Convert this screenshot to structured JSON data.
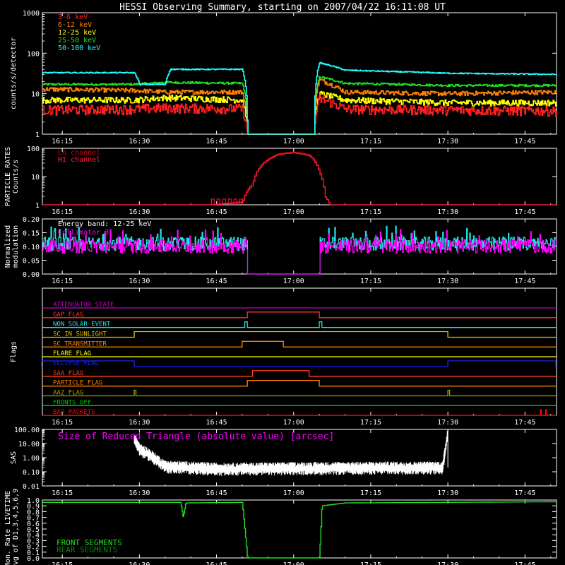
{
  "chart_data": {
    "type": "line",
    "title": "HESSI Observing Summary, starting on 2007/04/22 16:11:08 UT",
    "x_axis": {
      "units": "UT time",
      "range": [
        "16:11:08",
        "17:51:08"
      ],
      "tick_labels": [
        "16:15",
        "16:30",
        "16:45",
        "17:00",
        "17:15",
        "17:30",
        "17:45"
      ]
    },
    "panels": [
      {
        "id": "count-rates",
        "ylabel": "counts/s/detector",
        "yscale": "log",
        "ylim": [
          1,
          1000
        ],
        "tick_labels": [
          "1",
          "10",
          "100",
          "1000"
        ],
        "legend_position": "top-left",
        "series": [
          {
            "name": "3-6 keV",
            "color": "#ff2020",
            "points": [
              [
                "16:11",
                4.0
              ],
              [
                "16:29",
                4.2
              ],
              [
                "16:35",
                4.5
              ],
              [
                "16:50",
                4.3
              ],
              [
                "16:51",
                1.0
              ],
              [
                "17:04",
                1.0
              ],
              [
                "17:05",
                7.5
              ],
              [
                "17:10",
                4.2
              ],
              [
                "17:30",
                4.0
              ],
              [
                "17:51",
                3.8
              ]
            ]
          },
          {
            "name": "6-12 keV",
            "color": "#ff8000",
            "points": [
              [
                "16:11",
                13
              ],
              [
                "16:29",
                12
              ],
              [
                "16:35",
                11
              ],
              [
                "16:50",
                11
              ],
              [
                "16:51",
                1.0
              ],
              [
                "17:04",
                1.0
              ],
              [
                "17:05",
                22
              ],
              [
                "17:10",
                11
              ],
              [
                "17:30",
                10
              ],
              [
                "17:51",
                11
              ]
            ]
          },
          {
            "name": "12-25 keV",
            "color": "#ffff00",
            "points": [
              [
                "16:11",
                7
              ],
              [
                "16:29",
                7
              ],
              [
                "16:35",
                8
              ],
              [
                "16:50",
                7
              ],
              [
                "16:51",
                1.0
              ],
              [
                "17:04",
                1.0
              ],
              [
                "17:05",
                10
              ],
              [
                "17:10",
                7
              ],
              [
                "17:30",
                6
              ],
              [
                "17:51",
                6
              ]
            ]
          },
          {
            "name": "25-50 keV",
            "color": "#20e020",
            "points": [
              [
                "16:11",
                17
              ],
              [
                "16:29",
                17
              ],
              [
                "16:35",
                19
              ],
              [
                "16:50",
                18
              ],
              [
                "16:51",
                1.0
              ],
              [
                "17:04",
                1.0
              ],
              [
                "17:05",
                26
              ],
              [
                "17:10",
                18
              ],
              [
                "17:30",
                16
              ],
              [
                "17:51",
                16
              ]
            ]
          },
          {
            "name": "50-100 keV",
            "color": "#20ffff",
            "points": [
              [
                "16:11",
                33
              ],
              [
                "16:29",
                33
              ],
              [
                "16:30",
                17
              ],
              [
                "16:35",
                17
              ],
              [
                "16:36",
                40
              ],
              [
                "16:50",
                40
              ],
              [
                "16:51",
                1.0
              ],
              [
                "17:04",
                1.0
              ],
              [
                "17:05",
                58
              ],
              [
                "17:10",
                38
              ],
              [
                "17:30",
                32
              ],
              [
                "17:51",
                30
              ]
            ]
          }
        ]
      },
      {
        "id": "particle-rates",
        "ylabel": "PARTICLE RATES\nCounts/s",
        "yscale": "log",
        "ylim": [
          1,
          100
        ],
        "tick_labels": [
          "1",
          "10",
          "100"
        ],
        "legend_position": "top-left",
        "series": [
          {
            "name": "LO channel",
            "color": "#cc0000",
            "points": [
              [
                "16:11",
                1
              ],
              [
                "16:44",
                1
              ],
              [
                "16:50",
                1.3
              ],
              [
                "16:52",
                6
              ],
              [
                "16:54",
                30
              ],
              [
                "16:57",
                65
              ],
              [
                "17:00",
                75
              ],
              [
                "17:03",
                60
              ],
              [
                "17:05",
                15
              ],
              [
                "17:06",
                2
              ],
              [
                "17:07",
                1
              ],
              [
                "17:51",
                1
              ]
            ]
          },
          {
            "name": "HI channel",
            "color": "#ff2040",
            "points": [
              [
                "16:11",
                1
              ],
              [
                "16:44",
                1
              ],
              [
                "16:50",
                1.2
              ],
              [
                "16:52",
                5
              ],
              [
                "16:54",
                28
              ],
              [
                "16:57",
                60
              ],
              [
                "17:00",
                70
              ],
              [
                "17:03",
                55
              ],
              [
                "17:05",
                13
              ],
              [
                "17:06",
                2
              ],
              [
                "17:07",
                1
              ],
              [
                "17:51",
                1
              ]
            ]
          }
        ]
      },
      {
        "id": "modulation",
        "ylabel": "Normalized\nmodulation",
        "yscale": "linear",
        "ylim": [
          0.0,
          0.2
        ],
        "tick_labels": [
          "0.00",
          "0.05",
          "0.10",
          "0.15",
          "0.20"
        ],
        "legend_position": "top-left",
        "annotation": "Energy band: 12-25 keV",
        "series": [
          {
            "name": "Collimator 3",
            "color": "#ff00ff",
            "mean": 0.1,
            "gap": [
              "16:51",
              "17:05"
            ]
          },
          {
            "name": "",
            "color": "#20e0e0",
            "mean": 0.11,
            "gap": [
              "16:51",
              "17:05"
            ]
          }
        ]
      },
      {
        "id": "flags",
        "ylabel": "Flags",
        "flags": [
          {
            "name": "ATTENUATOR STATE",
            "color": "#c000c0",
            "on": []
          },
          {
            "name": "GAP FLAG",
            "color": "#ff3030",
            "on": [
              [
                "16:51",
                "17:05"
              ]
            ]
          },
          {
            "name": "NON SOLAR EVENT",
            "color": "#20e0e0",
            "on": [
              [
                "16:50:30",
                "16:51"
              ],
              [
                "17:05",
                "17:05:30"
              ]
            ]
          },
          {
            "name": "SC IN SUNLIGHT",
            "color": "#e0c000",
            "on": [
              [
                "16:29",
                "17:30"
              ]
            ]
          },
          {
            "name": "SC TRANSMITTER",
            "color": "#ff8000",
            "on": [
              [
                "16:50",
                "16:58"
              ]
            ]
          },
          {
            "name": "FLARE FLAG",
            "color": "#ffff00",
            "on": []
          },
          {
            "name": "ECLIPSE FLAG",
            "color": "#2020ff",
            "on": [
              [
                "16:11",
                "16:29"
              ],
              [
                "17:30",
                "17:51"
              ]
            ]
          },
          {
            "name": "SAA FLAG",
            "color": "#ff4020",
            "on": [
              [
                "16:52",
                "17:03"
              ]
            ]
          },
          {
            "name": "PARTICLE FLAG",
            "color": "#ff8000",
            "on": [
              [
                "16:51",
                "17:05"
              ]
            ]
          },
          {
            "name": "AAZ FLAG",
            "color": "#a0a000",
            "on": [
              [
                "16:29",
                "16:29:20"
              ],
              [
                "17:30",
                "17:30:20"
              ]
            ]
          },
          {
            "name": "FRONTS OFF",
            "color": "#00c000",
            "on": []
          },
          {
            "name": "BAD PACKETS",
            "color": "#ff0000",
            "on": [
              [
                "17:48",
                "17:48:10"
              ],
              [
                "17:49",
                "17:49:10"
              ]
            ]
          }
        ]
      },
      {
        "id": "sas",
        "ylabel": "SAS",
        "yscale": "log",
        "ylim": [
          0.01,
          100
        ],
        "tick_labels": [
          "0.01",
          "0.10",
          "1.00",
          "10.00",
          "100.00"
        ],
        "legend_position": "top-left",
        "series": [
          {
            "name": "Size of Reduced Triangle (absolute value) [arcsec]",
            "color": "#ff00ff"
          },
          {
            "name": "",
            "color": "#ffffff",
            "points": [
              [
                "16:29",
                30
              ],
              [
                "16:30",
                5
              ],
              [
                "16:32",
                2
              ],
              [
                "16:35",
                0.3
              ],
              [
                "16:45",
                0.2
              ],
              [
                "17:00",
                0.22
              ],
              [
                "17:15",
                0.24
              ],
              [
                "17:29",
                0.25
              ],
              [
                "17:30",
                90
              ]
            ]
          }
        ]
      },
      {
        "id": "livetime",
        "ylabel": "Mon. Rate LIVETIME\navg of D1,3,4,5,6,9",
        "yscale": "linear",
        "ylim": [
          0.0,
          1.0
        ],
        "tick_labels": [
          "0.0",
          "0.1",
          "0.2",
          "0.3",
          "0.4",
          "0.5",
          "0.6",
          "0.7",
          "0.8",
          "0.9",
          "1.0"
        ],
        "legend_position": "bottom-left",
        "series": [
          {
            "name": "FRONT SEGMENTS",
            "color": "#20e020",
            "points": [
              [
                "16:11",
                0.96
              ],
              [
                "16:38",
                0.96
              ],
              [
                "16:38:30",
                0.7
              ],
              [
                "16:39",
                0.95
              ],
              [
                "16:50",
                0.96
              ],
              [
                "16:51",
                0.0
              ],
              [
                "17:05",
                0.0
              ],
              [
                "17:05:30",
                0.9
              ],
              [
                "17:10",
                0.95
              ],
              [
                "17:51",
                0.97
              ]
            ]
          },
          {
            "name": "REAR SEGMENTS",
            "color": "#108010",
            "points": []
          }
        ]
      }
    ]
  }
}
